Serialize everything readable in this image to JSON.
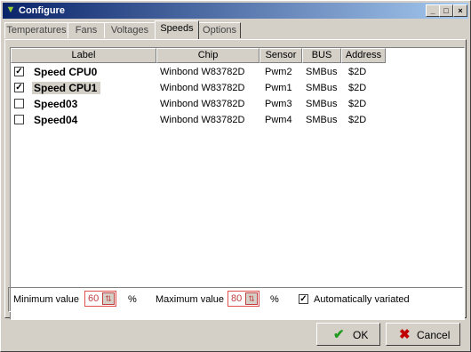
{
  "window": {
    "title": "Configure",
    "icon": "app-icon",
    "controls": [
      "_",
      "□",
      "×"
    ]
  },
  "tabs": [
    {
      "label": "Temperatures",
      "active": false
    },
    {
      "label": "Fans",
      "active": false
    },
    {
      "label": "Voltages",
      "active": false
    },
    {
      "label": "Speeds",
      "active": true
    },
    {
      "label": "Options",
      "active": false
    }
  ],
  "table": {
    "columns": [
      "Label",
      "Chip",
      "Sensor",
      "BUS",
      "Address"
    ],
    "rows": [
      {
        "checked": true,
        "label": "Speed CPU0",
        "chip": "Winbond W83782D",
        "sensor": "Pwm2",
        "bus": "SMBus",
        "address": "$2D",
        "selected": false
      },
      {
        "checked": true,
        "label": "Speed CPU1",
        "chip": "Winbond W83782D",
        "sensor": "Pwm1",
        "bus": "SMBus",
        "address": "$2D",
        "selected": true
      },
      {
        "checked": false,
        "label": "Speed03",
        "chip": "Winbond W83782D",
        "sensor": "Pwm3",
        "bus": "SMBus",
        "address": "$2D",
        "selected": false
      },
      {
        "checked": false,
        "label": "Speed04",
        "chip": "Winbond W83782D",
        "sensor": "Pwm4",
        "bus": "SMBus",
        "address": "$2D",
        "selected": false
      }
    ]
  },
  "bottom": {
    "min_label": "Minimum value",
    "min_value": "60",
    "min_unit": "%",
    "max_label": "Maximum value",
    "max_value": "80",
    "max_unit": "%",
    "auto_label": "Automatically variated",
    "auto_checked": true
  },
  "buttons": {
    "ok_label": "OK",
    "cancel_label": "Cancel"
  },
  "colors": {
    "titlebar_start": "#0a246a",
    "titlebar_end": "#a6caf0",
    "spin_accent": "#c04040",
    "ok_icon": "#1f9a1f",
    "cancel_icon": "#c00000"
  }
}
